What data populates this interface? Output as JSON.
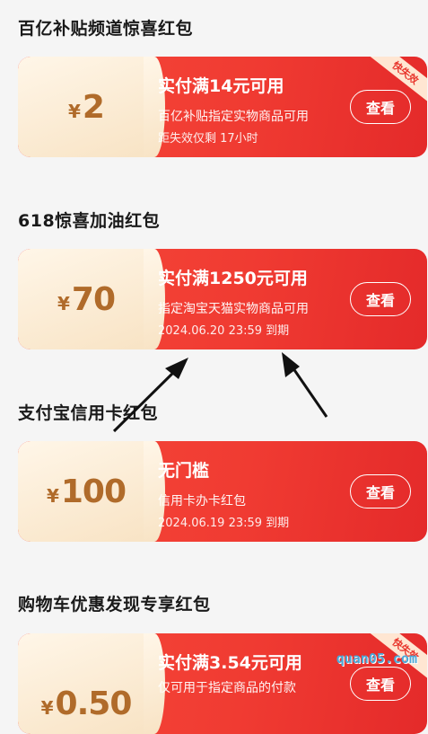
{
  "sections": [
    {
      "title": "百亿补贴频道惊喜红包",
      "coupon": {
        "currency": "¥",
        "amount": "2",
        "condition": "实付满14元可用",
        "description": "百亿补贴指定实物商品可用",
        "expire": "距失效仅剩 17小时",
        "button": "查看",
        "tag": "快失效"
      }
    },
    {
      "title": "618惊喜加油红包",
      "coupon": {
        "currency": "¥",
        "amount": "70",
        "condition": "实付满1250元可用",
        "description": "指定淘宝天猫实物商品可用",
        "expire": "2024.06.20 23:59 到期",
        "button": "查看"
      }
    },
    {
      "title": "支付宝信用卡红包",
      "coupon": {
        "currency": "¥",
        "amount": "100",
        "condition": "无门槛",
        "description": "信用卡办卡红包",
        "expire": "2024.06.19 23:59 到期",
        "button": "查看"
      }
    },
    {
      "title": "购物车优惠发现专享红包",
      "coupon": {
        "currency": "¥",
        "amount": "0.50",
        "condition": "实付满3.54元可用",
        "description": "仅可用于指定商品的付款",
        "button": "查看",
        "tag": "快失效"
      }
    }
  ],
  "watermark": "quan05.com",
  "colors": {
    "card_red": "#f03b32",
    "amount_brown": "#b06b2a",
    "amount_panel": "#f8e3c4",
    "background": "#f5f5f5"
  }
}
